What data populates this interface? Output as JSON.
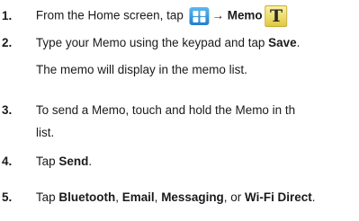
{
  "steps": [
    {
      "number": "1.",
      "text_before": "From the Home screen, tap",
      "arrow": "→",
      "bold_target": "Memo",
      "icons": [
        "apps-grid-icon",
        "memo-app-icon"
      ]
    },
    {
      "number": "2.",
      "text_before": "Type your Memo using the keypad and tap",
      "bold_target": "Save",
      "text_after": ".",
      "continuation": "The memo will display in the memo list."
    },
    {
      "number": "3.",
      "text_line1": "To send a Memo, touch and hold the Memo in th",
      "text_line2": "list."
    },
    {
      "number": "4.",
      "text_before": "Tap",
      "bold_target": "Send",
      "text_after": "."
    },
    {
      "number": "5.",
      "text_before": "Tap",
      "option1": "Bluetooth",
      "sep1": ",",
      "option2": "Email",
      "sep2": ",",
      "option3": "Messaging",
      "sep3": ", or",
      "option4": "Wi-Fi Direct",
      "text_after": "."
    }
  ],
  "memo_icon_letter": "T",
  "colors": {
    "apps_icon": "#1f7fd0",
    "memo_icon": "#e0c843"
  }
}
